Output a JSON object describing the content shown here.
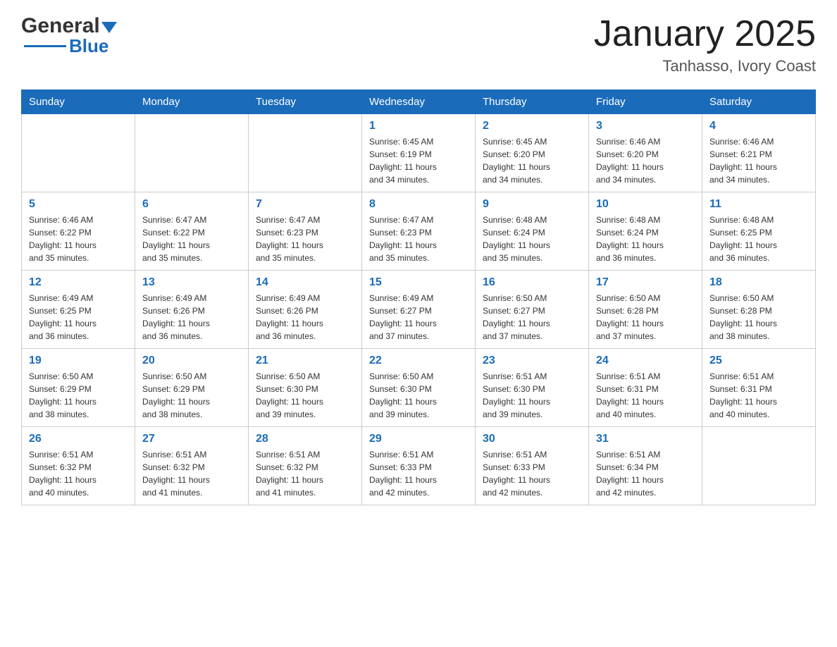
{
  "header": {
    "logo_general": "General",
    "logo_blue": "Blue",
    "month_title": "January 2025",
    "location": "Tanhasso, Ivory Coast"
  },
  "days_of_week": [
    "Sunday",
    "Monday",
    "Tuesday",
    "Wednesday",
    "Thursday",
    "Friday",
    "Saturday"
  ],
  "weeks": [
    [
      {
        "day": "",
        "info": ""
      },
      {
        "day": "",
        "info": ""
      },
      {
        "day": "",
        "info": ""
      },
      {
        "day": "1",
        "info": "Sunrise: 6:45 AM\nSunset: 6:19 PM\nDaylight: 11 hours\nand 34 minutes."
      },
      {
        "day": "2",
        "info": "Sunrise: 6:45 AM\nSunset: 6:20 PM\nDaylight: 11 hours\nand 34 minutes."
      },
      {
        "day": "3",
        "info": "Sunrise: 6:46 AM\nSunset: 6:20 PM\nDaylight: 11 hours\nand 34 minutes."
      },
      {
        "day": "4",
        "info": "Sunrise: 6:46 AM\nSunset: 6:21 PM\nDaylight: 11 hours\nand 34 minutes."
      }
    ],
    [
      {
        "day": "5",
        "info": "Sunrise: 6:46 AM\nSunset: 6:22 PM\nDaylight: 11 hours\nand 35 minutes."
      },
      {
        "day": "6",
        "info": "Sunrise: 6:47 AM\nSunset: 6:22 PM\nDaylight: 11 hours\nand 35 minutes."
      },
      {
        "day": "7",
        "info": "Sunrise: 6:47 AM\nSunset: 6:23 PM\nDaylight: 11 hours\nand 35 minutes."
      },
      {
        "day": "8",
        "info": "Sunrise: 6:47 AM\nSunset: 6:23 PM\nDaylight: 11 hours\nand 35 minutes."
      },
      {
        "day": "9",
        "info": "Sunrise: 6:48 AM\nSunset: 6:24 PM\nDaylight: 11 hours\nand 35 minutes."
      },
      {
        "day": "10",
        "info": "Sunrise: 6:48 AM\nSunset: 6:24 PM\nDaylight: 11 hours\nand 36 minutes."
      },
      {
        "day": "11",
        "info": "Sunrise: 6:48 AM\nSunset: 6:25 PM\nDaylight: 11 hours\nand 36 minutes."
      }
    ],
    [
      {
        "day": "12",
        "info": "Sunrise: 6:49 AM\nSunset: 6:25 PM\nDaylight: 11 hours\nand 36 minutes."
      },
      {
        "day": "13",
        "info": "Sunrise: 6:49 AM\nSunset: 6:26 PM\nDaylight: 11 hours\nand 36 minutes."
      },
      {
        "day": "14",
        "info": "Sunrise: 6:49 AM\nSunset: 6:26 PM\nDaylight: 11 hours\nand 36 minutes."
      },
      {
        "day": "15",
        "info": "Sunrise: 6:49 AM\nSunset: 6:27 PM\nDaylight: 11 hours\nand 37 minutes."
      },
      {
        "day": "16",
        "info": "Sunrise: 6:50 AM\nSunset: 6:27 PM\nDaylight: 11 hours\nand 37 minutes."
      },
      {
        "day": "17",
        "info": "Sunrise: 6:50 AM\nSunset: 6:28 PM\nDaylight: 11 hours\nand 37 minutes."
      },
      {
        "day": "18",
        "info": "Sunrise: 6:50 AM\nSunset: 6:28 PM\nDaylight: 11 hours\nand 38 minutes."
      }
    ],
    [
      {
        "day": "19",
        "info": "Sunrise: 6:50 AM\nSunset: 6:29 PM\nDaylight: 11 hours\nand 38 minutes."
      },
      {
        "day": "20",
        "info": "Sunrise: 6:50 AM\nSunset: 6:29 PM\nDaylight: 11 hours\nand 38 minutes."
      },
      {
        "day": "21",
        "info": "Sunrise: 6:50 AM\nSunset: 6:30 PM\nDaylight: 11 hours\nand 39 minutes."
      },
      {
        "day": "22",
        "info": "Sunrise: 6:50 AM\nSunset: 6:30 PM\nDaylight: 11 hours\nand 39 minutes."
      },
      {
        "day": "23",
        "info": "Sunrise: 6:51 AM\nSunset: 6:30 PM\nDaylight: 11 hours\nand 39 minutes."
      },
      {
        "day": "24",
        "info": "Sunrise: 6:51 AM\nSunset: 6:31 PM\nDaylight: 11 hours\nand 40 minutes."
      },
      {
        "day": "25",
        "info": "Sunrise: 6:51 AM\nSunset: 6:31 PM\nDaylight: 11 hours\nand 40 minutes."
      }
    ],
    [
      {
        "day": "26",
        "info": "Sunrise: 6:51 AM\nSunset: 6:32 PM\nDaylight: 11 hours\nand 40 minutes."
      },
      {
        "day": "27",
        "info": "Sunrise: 6:51 AM\nSunset: 6:32 PM\nDaylight: 11 hours\nand 41 minutes."
      },
      {
        "day": "28",
        "info": "Sunrise: 6:51 AM\nSunset: 6:32 PM\nDaylight: 11 hours\nand 41 minutes."
      },
      {
        "day": "29",
        "info": "Sunrise: 6:51 AM\nSunset: 6:33 PM\nDaylight: 11 hours\nand 42 minutes."
      },
      {
        "day": "30",
        "info": "Sunrise: 6:51 AM\nSunset: 6:33 PM\nDaylight: 11 hours\nand 42 minutes."
      },
      {
        "day": "31",
        "info": "Sunrise: 6:51 AM\nSunset: 6:34 PM\nDaylight: 11 hours\nand 42 minutes."
      },
      {
        "day": "",
        "info": ""
      }
    ]
  ]
}
